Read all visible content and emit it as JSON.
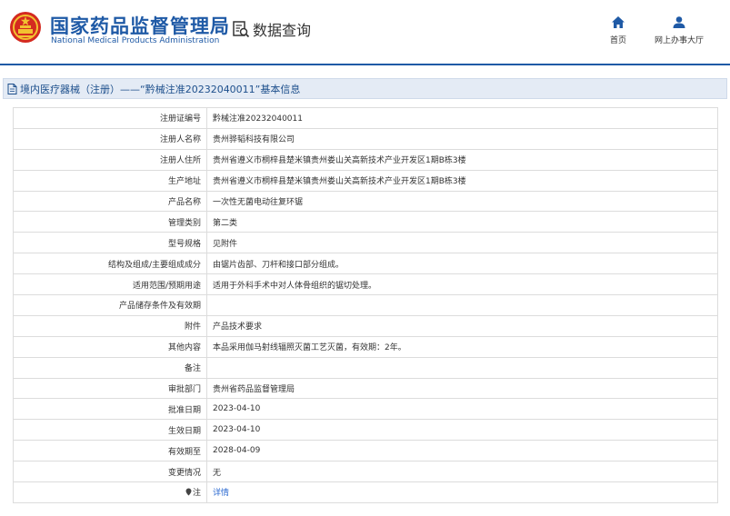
{
  "header": {
    "brand_cn": "国家药品监督管理局",
    "brand_en": "National Medical Products Administration",
    "section_title": "数据查询",
    "nav": [
      {
        "label": "首页",
        "icon": "home-icon"
      },
      {
        "label": "网上办事大厅",
        "icon": "user-icon"
      }
    ],
    "colors": {
      "brand": "#1f5aa6",
      "logo_red": "#d42a20",
      "logo_gold": "#f2c230",
      "link": "#2d6bd1"
    }
  },
  "section": {
    "title": "境内医疗器械（注册）——“黔械注准20232040011”基本信息"
  },
  "record": {
    "rows": [
      {
        "label": "注册证编号",
        "value": "黔械注准20232040011"
      },
      {
        "label": "注册人名称",
        "value": "贵州骅韬科技有限公司"
      },
      {
        "label": "注册人住所",
        "value": "贵州省遵义市桐梓县楚米镇贵州娄山关高新技术产业开发区1期B栋3楼"
      },
      {
        "label": "生产地址",
        "value": "贵州省遵义市桐梓县楚米镇贵州娄山关高新技术产业开发区1期B栋3楼"
      },
      {
        "label": "产品名称",
        "value": "一次性无菌电动往复环锯"
      },
      {
        "label": "管理类别",
        "value": "第二类"
      },
      {
        "label": "型号规格",
        "value": "见附件"
      },
      {
        "label": "结构及组成/主要组成成分",
        "value": "由锯片齿部、刀杆和接口部分组成。"
      },
      {
        "label": "适用范围/预期用途",
        "value": "适用于外科手术中对人体骨组织的锯切处理。"
      },
      {
        "label": "产品储存条件及有效期",
        "value": ""
      },
      {
        "label": "附件",
        "value": "产品技术要求"
      },
      {
        "label": "其他内容",
        "value": "本品采用伽马射线辐照灭菌工艺灭菌，有效期：2年。"
      },
      {
        "label": "备注",
        "value": ""
      },
      {
        "label": "审批部门",
        "value": "贵州省药品监督管理局"
      },
      {
        "label": "批准日期",
        "value": "2023-04-10"
      },
      {
        "label": "生效日期",
        "value": "2023-04-10"
      },
      {
        "label": "有效期至",
        "value": "2028-04-09"
      },
      {
        "label": "变更情况",
        "value": "无"
      }
    ],
    "note_label": "注",
    "note_icon": "pin-icon",
    "detail_link": "详情"
  }
}
